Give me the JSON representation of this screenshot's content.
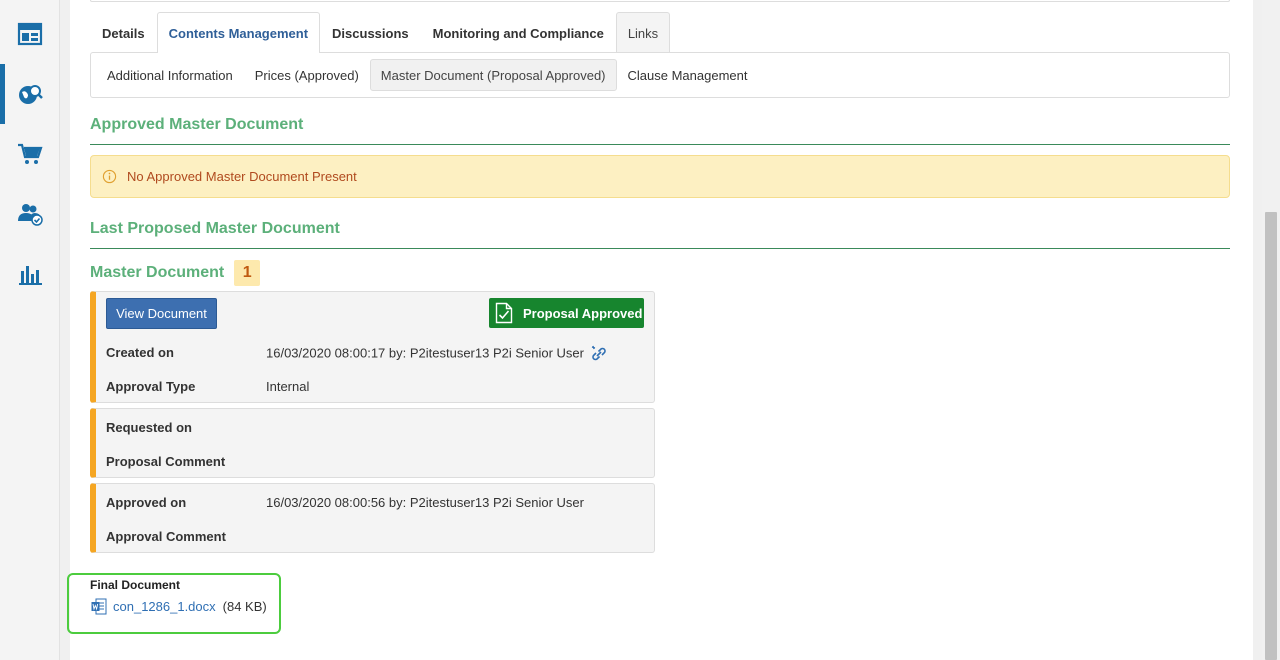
{
  "nav": {
    "items": [
      {
        "name": "layout-icon",
        "active": false
      },
      {
        "name": "globe-search-icon",
        "active": true
      },
      {
        "name": "cart-icon",
        "active": false
      },
      {
        "name": "users-check-icon",
        "active": false
      },
      {
        "name": "bar-chart-icon",
        "active": false
      }
    ]
  },
  "tabs": [
    {
      "label": "Details"
    },
    {
      "label": "Contents Management"
    },
    {
      "label": "Discussions"
    },
    {
      "label": "Monitoring and Compliance"
    },
    {
      "label": "Links"
    }
  ],
  "subtabs": [
    {
      "label": "Additional Information"
    },
    {
      "label": "Prices (Approved)"
    },
    {
      "label": "Master Document (Proposal Approved)"
    },
    {
      "label": "Clause Management"
    }
  ],
  "approved_section": {
    "title": "Approved Master Document",
    "alert": "No Approved Master Document Present"
  },
  "proposed_section": {
    "title": "Last Proposed Master Document",
    "master_label": "Master Document",
    "master_count": "1",
    "view_button": "View Document",
    "status": "Proposal Approved",
    "created_label": "Created on",
    "created_value": "16/03/2020 08:00:17 by: P2itestuser13 P2i Senior User",
    "approval_type_label": "Approval Type",
    "approval_type_value": "Internal",
    "requested_label": "Requested on",
    "proposal_comment_label": "Proposal Comment",
    "approved_label": "Approved on",
    "approved_value": "16/03/2020 08:00:56 by: P2itestuser13 P2i Senior User",
    "approval_comment_label": "Approval Comment"
  },
  "final_document": {
    "title": "Final Document",
    "file_name": "con_1286_1.docx",
    "file_size": "(84 KB)"
  },
  "colors": {
    "accent": "#1a6ea8",
    "section_green": "#5cb07a",
    "status_green": "#17852e",
    "card_stripe": "#f5a623",
    "highlight": "#4ccc3e"
  }
}
